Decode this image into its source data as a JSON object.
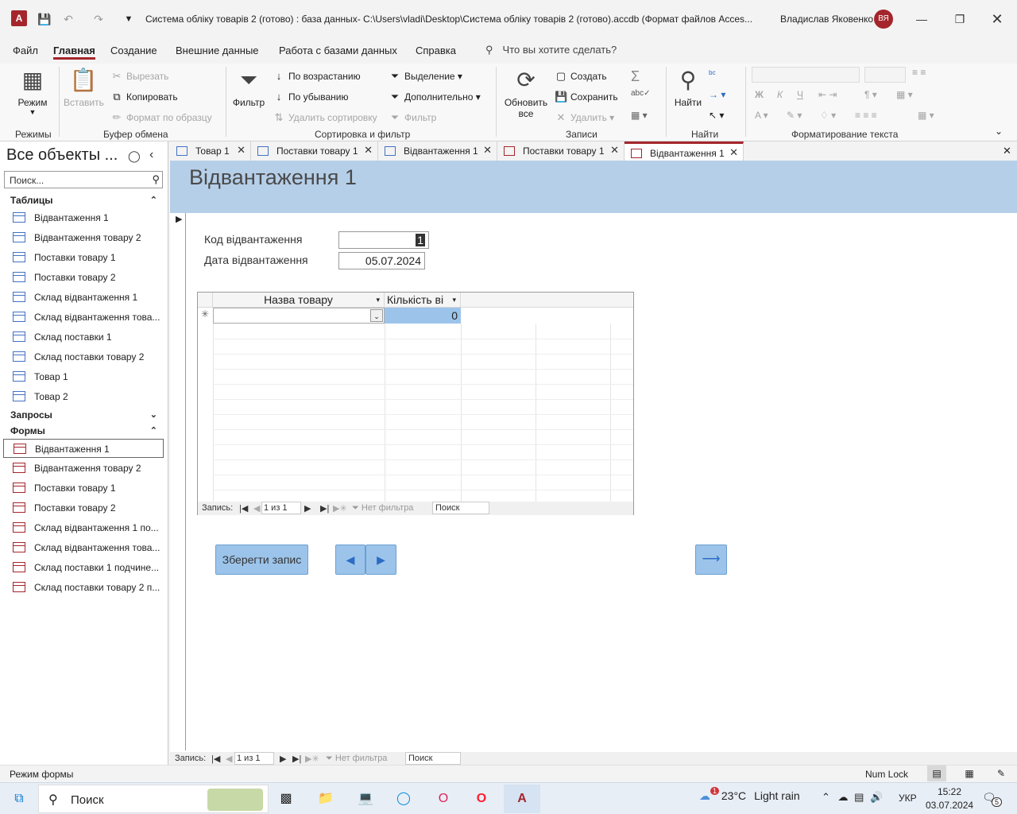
{
  "titlebar": {
    "title": "Система обліку товарів 2 (готово) : база данных- C:\\Users\\vladi\\Desktop\\Система обліку товарів 2 (готово).accdb (Формат файлов Acces...",
    "user": "Владислав Яковенко",
    "avatar": "ВЯ"
  },
  "ribbon_tabs": [
    "Файл",
    "Главная",
    "Создание",
    "Внешние данные",
    "Работа с базами данных",
    "Справка"
  ],
  "tellme": "Что вы хотите сделать?",
  "ribbon": {
    "views": {
      "mode": "Режим",
      "group": "Режимы"
    },
    "clipboard": {
      "paste": "Вставить",
      "cut": "Вырезать",
      "copy": "Копировать",
      "format": "Формат по образцу",
      "group": "Буфер обмена"
    },
    "sort": {
      "filter": "Фильтр",
      "asc": "По возрастанию",
      "desc": "По убыванию",
      "remove": "Удалить сортировку",
      "selection": "Выделение",
      "advanced": "Дополнительно",
      "toggle": "Фильтр",
      "group": "Сортировка и фильтр"
    },
    "records": {
      "refresh1": "Обновить",
      "refresh2": "все",
      "new": "Создать",
      "save": "Сохранить",
      "delete": "Удалить",
      "group": "Записи"
    },
    "find": {
      "find": "Найти",
      "group": "Найти"
    },
    "text": {
      "bold": "Ж",
      "italic": "К",
      "underline": "Ч",
      "group": "Форматирование текста"
    }
  },
  "nav": {
    "header": "Все объекты ...",
    "search_placeholder": "Поиск...",
    "groups": {
      "tables": "Таблицы",
      "queries": "Запросы",
      "forms": "Формы"
    },
    "tables": [
      "Відвантаження 1",
      "Відвантаження товару 2",
      "Поставки товару 1",
      "Поставки товару 2",
      "Склад відвантаження 1",
      "Склад відвантаження това...",
      "Склад поставки 1",
      "Склад поставки товару 2",
      "Товар 1",
      "Товар 2"
    ],
    "forms": [
      "Відвантаження 1",
      "Відвантаження товару 2",
      "Поставки товару 1",
      "Поставки товару 2",
      "Склад відвантаження 1 по...",
      "Склад відвантаження това...",
      "Склад поставки 1 подчине...",
      "Склад поставки товару 2 п..."
    ]
  },
  "doc_tabs": [
    {
      "label": "Товар 1",
      "type": "table"
    },
    {
      "label": "Поставки товару 1",
      "type": "table"
    },
    {
      "label": "Відвантаження 1",
      "type": "table"
    },
    {
      "label": "Поставки товару 1",
      "type": "form"
    },
    {
      "label": "Відвантаження 1",
      "type": "form"
    }
  ],
  "form": {
    "title": "Відвантаження 1",
    "fields": {
      "code_label": "Код відвантаження",
      "code_value": "1",
      "date_label": "Дата відвантаження",
      "date_value": "05.07.2024"
    },
    "subform": {
      "columns": [
        "Назва товару",
        "Кількість ві"
      ],
      "new_row_marker": "✳",
      "qty_value": "0",
      "navbar": {
        "label": "Запись:",
        "position": "1 из 1",
        "filter": "Нет фильтра",
        "search": "Поиск"
      }
    },
    "buttons": {
      "save": "Зберегти запис"
    }
  },
  "main_navbar": {
    "label": "Запись:",
    "position": "1 из 1",
    "filter": "Нет фильтра",
    "search": "Поиск"
  },
  "statusbar": {
    "mode": "Режим формы",
    "numlock": "Num Lock"
  },
  "taskbar": {
    "search": "Поиск",
    "weather_temp": "23°C",
    "weather_desc": "Light rain",
    "weather_badge": "1",
    "lang": "УКР",
    "time": "15:22",
    "date": "03.07.2024",
    "notif_count": "5"
  },
  "colors": {
    "accent": "#a4262c",
    "form_header": "#b6cfe9",
    "button": "#9cc4ea"
  }
}
